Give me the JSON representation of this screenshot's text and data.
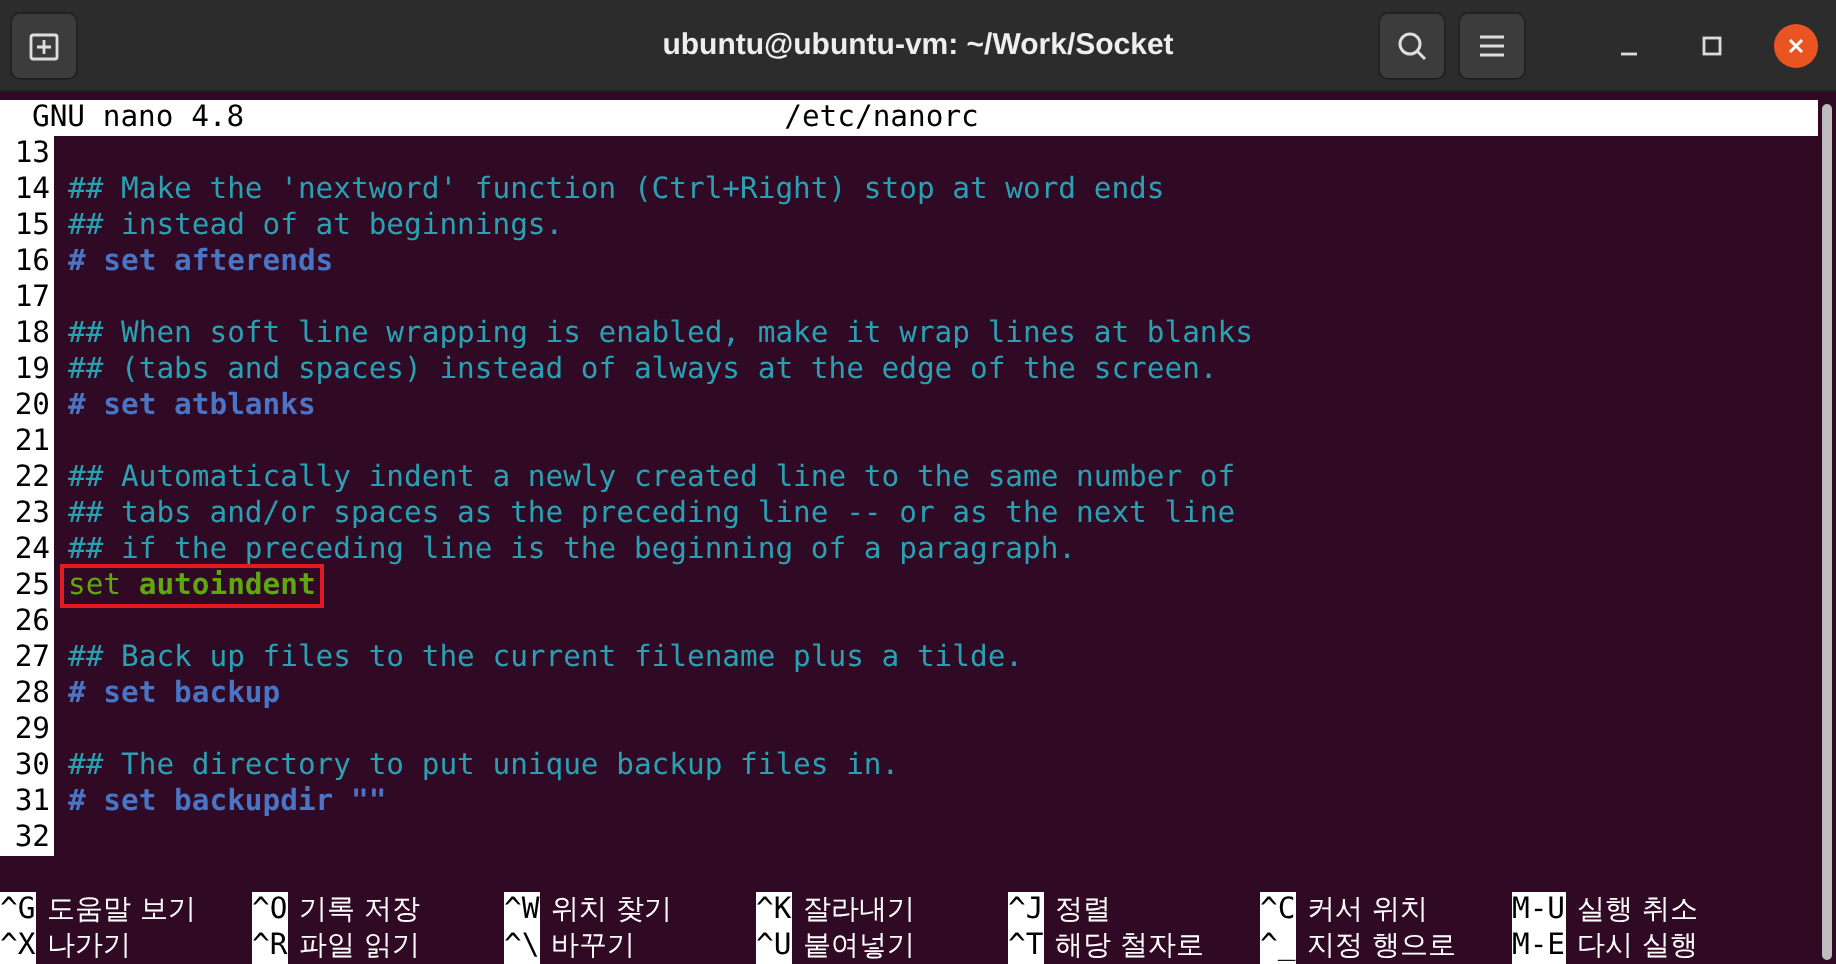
{
  "window": {
    "title": "ubuntu@ubuntu-vm: ~/Work/Socket"
  },
  "editor": {
    "app": "GNU nano 4.8",
    "file": "/etc/nanorc"
  },
  "lines": [
    {
      "number": "13"
    },
    {
      "number": "14",
      "kind": "comment",
      "text": "## Make the 'nextword' function (Ctrl+Right) stop at word ends"
    },
    {
      "number": "15",
      "kind": "comment",
      "text": "## instead of at beginnings."
    },
    {
      "number": "16",
      "kind": "disabled",
      "text": "# set afterends"
    },
    {
      "number": "17"
    },
    {
      "number": "18",
      "kind": "comment",
      "text": "## When soft line wrapping is enabled, make it wrap lines at blanks"
    },
    {
      "number": "19",
      "kind": "comment",
      "text": "## (tabs and spaces) instead of always at the edge of the screen."
    },
    {
      "number": "20",
      "kind": "disabled",
      "text": "# set atblanks"
    },
    {
      "number": "21"
    },
    {
      "number": "22",
      "kind": "comment",
      "text": "## Automatically indent a newly created line to the same number of"
    },
    {
      "number": "23",
      "kind": "comment",
      "text": "## tabs and/or spaces as the preceding line -- or as the next line"
    },
    {
      "number": "24",
      "kind": "comment",
      "text": "## if the preceding line is the beginning of a paragraph."
    },
    {
      "number": "25",
      "kind": "option",
      "text": "set **autoindent**",
      "highlighted": true
    },
    {
      "number": "26"
    },
    {
      "number": "27",
      "kind": "comment",
      "text": "## Back up files to the current filename plus a tilde."
    },
    {
      "number": "28",
      "kind": "disabled",
      "text": "# set backup"
    },
    {
      "number": "29"
    },
    {
      "number": "30",
      "kind": "comment",
      "text": "## The directory to put unique backup files in."
    },
    {
      "number": "31",
      "kind": "disabled",
      "text": "# set backupdir \"\""
    },
    {
      "number": "32"
    }
  ],
  "shortcuts": [
    [
      {
        "key": "^G",
        "label": "도움말 보기"
      },
      {
        "key": "^O",
        "label": "기록 저장"
      },
      {
        "key": "^W",
        "label": "위치 찾기"
      },
      {
        "key": "^K",
        "label": "잘라내기"
      },
      {
        "key": "^J",
        "label": "정렬"
      },
      {
        "key": "^C",
        "label": "커서 위치"
      },
      {
        "key": "M-U",
        "label": "실행 취소"
      }
    ],
    [
      {
        "key": "^X",
        "label": "나가기"
      },
      {
        "key": "^R",
        "label": "파일 읽기"
      },
      {
        "key": "^\\",
        "label": "바꾸기"
      },
      {
        "key": "^U",
        "label": "붙여넣기"
      },
      {
        "key": "^T",
        "label": "해당 철자로"
      },
      {
        "key": "^_",
        "label": "지정 행으로"
      },
      {
        "key": "M-E",
        "label": "다시 실행"
      }
    ]
  ]
}
